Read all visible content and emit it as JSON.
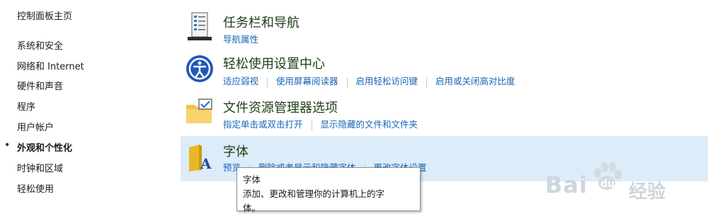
{
  "sidebar": {
    "home": "控制面板主页",
    "items": [
      {
        "label": "系统和安全"
      },
      {
        "label": "网络和 Internet"
      },
      {
        "label": "硬件和声音"
      },
      {
        "label": "程序"
      },
      {
        "label": "用户帐户"
      },
      {
        "label": "外观和个性化",
        "active": true
      },
      {
        "label": "时钟和区域"
      },
      {
        "label": "轻松使用"
      }
    ]
  },
  "categories": [
    {
      "title": "任务栏和导航",
      "icon": "taskbar-icon",
      "links": [
        "导航属性"
      ]
    },
    {
      "title": "轻松使用设置中心",
      "icon": "ease-of-access-icon",
      "links": [
        "适应弱视",
        "使用屏幕阅读器",
        "启用轻松访问键",
        "启用或关闭高对比度"
      ]
    },
    {
      "title": "文件资源管理器选项",
      "icon": "folder-options-icon",
      "links": [
        "指定单击或双击打开",
        "显示隐藏的文件和文件夹"
      ]
    },
    {
      "title": "字体",
      "icon": "fonts-icon",
      "links": [
        "预览",
        "删除或者显示和隐藏字体",
        "更改字体设置"
      ]
    }
  ],
  "tooltip": {
    "line1": "字体",
    "line2": "添加、更改和管理你的计算机上的字",
    "line3": "体。"
  },
  "watermark": {
    "text1": "Bai",
    "text2": "du",
    "text3": "经验"
  },
  "colors": {
    "highlight": "#dcecf9",
    "link": "#1565b7",
    "title": "#1c3f16"
  }
}
